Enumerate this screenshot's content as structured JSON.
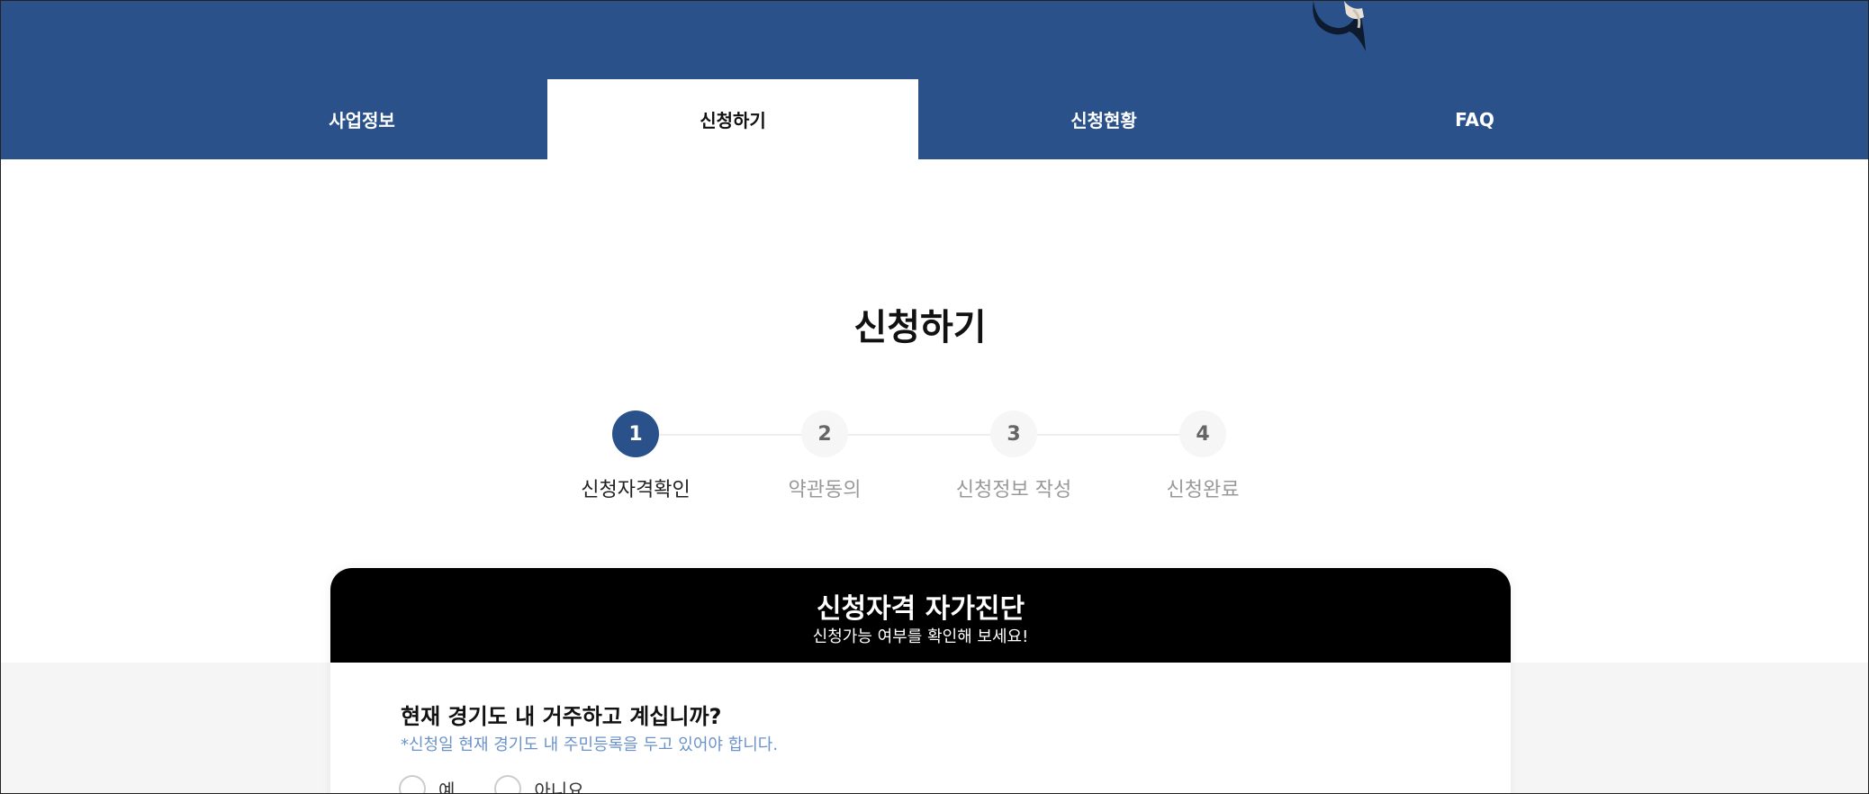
{
  "nav": {
    "tabs": [
      {
        "label": "사업정보"
      },
      {
        "label": "신청하기"
      },
      {
        "label": "신청현황"
      },
      {
        "label": "FAQ"
      }
    ],
    "active_index": 1
  },
  "page": {
    "title": "신청하기"
  },
  "steps": [
    {
      "number": "1",
      "label": "신청자격확인"
    },
    {
      "number": "2",
      "label": "약관동의"
    },
    {
      "number": "3",
      "label": "신청정보 작성"
    },
    {
      "number": "4",
      "label": "신청완료"
    }
  ],
  "current_step": 1,
  "card": {
    "title": "신청자격 자가진단",
    "subtitle": "신청가능 여부를 확인해 보세요!",
    "question": "현재 경기도 내 거주하고 계십니까?",
    "notice": "*신청일 현재 경기도 내 주민등록을 두고 있어야 합니다.",
    "options": [
      {
        "label": "예"
      },
      {
        "label": "아니요"
      }
    ]
  },
  "colors": {
    "header": "#2a518a",
    "active_step": "#2a518a",
    "card_header": "#000000",
    "notice": "#6b93c9"
  },
  "icons": [
    "header-character-illustration"
  ]
}
